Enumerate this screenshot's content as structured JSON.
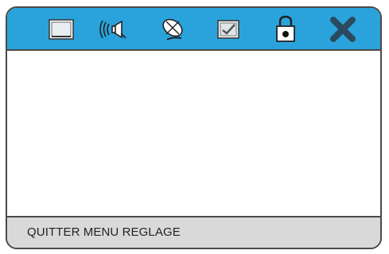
{
  "menu": {
    "icons": [
      {
        "name": "picture-icon"
      },
      {
        "name": "sound-icon"
      },
      {
        "name": "satellite-dish-icon"
      },
      {
        "name": "settings-checklist-icon"
      },
      {
        "name": "lock-icon"
      },
      {
        "name": "exit-icon"
      }
    ]
  },
  "footer": {
    "label": "QUITTER MENU REGLAGE"
  },
  "colors": {
    "topbar": "#2aa3dc",
    "footer": "#d9d9d9",
    "border": "#4a4a4a",
    "exit_icon": "#2b4a5f"
  }
}
